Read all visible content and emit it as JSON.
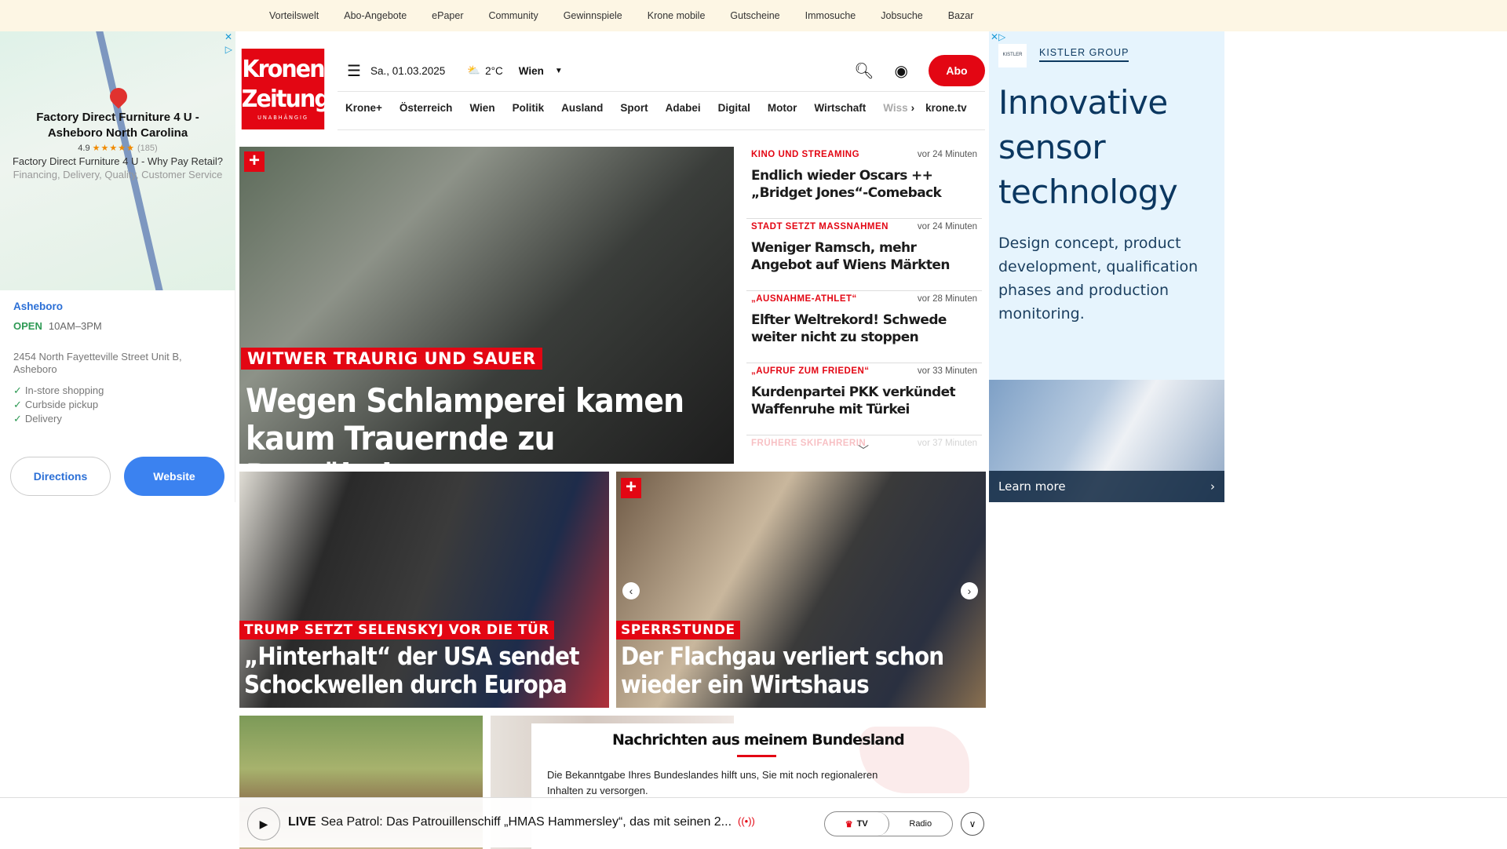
{
  "topbar": [
    "Vorteilswelt",
    "Abo-Angebote",
    "ePaper",
    "Community",
    "Gewinnspiele",
    "Krone mobile",
    "Gutscheine",
    "Immosuche",
    "Jobsuche",
    "Bazar"
  ],
  "left_ad": {
    "title": "Factory Direct Furniture 4 U - Asheboro North Carolina",
    "rating": "4.9",
    "stars": "★★★★★",
    "reviews": "(185)",
    "desc": "Factory Direct Furniture 4 U - Why Pay Retail?",
    "desc2": "Financing, Delivery, Quality, Customer Service",
    "city": "Asheboro",
    "open": "OPEN",
    "hours": "10AM–3PM",
    "address": "2454 North Fayetteville Street Unit B, Asheboro",
    "features": [
      "In-store shopping",
      "Curbside pickup",
      "Delivery"
    ],
    "directions": "Directions",
    "website": "Website"
  },
  "logo": {
    "line1": "Kronen",
    "line2": "Zeitung",
    "sub": "UNABHÄNGIG"
  },
  "header": {
    "date": "Sa., 01.03.2025",
    "temp": "2°C",
    "city": "Wien",
    "abo": "Abo"
  },
  "nav": [
    "Krone+",
    "Österreich",
    "Wien",
    "Politik",
    "Ausland",
    "Sport",
    "Adabei",
    "Digital",
    "Motor",
    "Wirtschaft",
    "Wiss",
    "krone.tv"
  ],
  "hero": {
    "kicker": "WITWER TRAURIG UND SAUER",
    "headline": "Wegen Schlamperei kamen kaum Trauernde zu Begräbnis"
  },
  "list": [
    {
      "kicker": "KINO UND STREAMING",
      "time": "vor 24 Minuten",
      "headline": "Endlich wieder Oscars ++ „Bridget Jones“-Comeback"
    },
    {
      "kicker": "STADT SETZT MASSNAHMEN",
      "time": "vor 24 Minuten",
      "headline": "Weniger Ramsch, mehr Angebot auf Wiens Märkten"
    },
    {
      "kicker": "„AUSNAHME-ATHLET“",
      "time": "vor 28 Minuten",
      "headline": "Elfter Weltrekord! Schwede weiter nicht zu stoppen"
    },
    {
      "kicker": "„AUFRUF ZUM FRIEDEN“",
      "time": "vor 33 Minuten",
      "headline": "Kurdenpartei PKK verkündet Waffenruhe mit Türkei"
    },
    {
      "kicker": "FRÜHERE SKIFAHRERIN",
      "time": "vor 37 Minuten",
      "headline": ""
    }
  ],
  "carousel": {
    "slides": 5,
    "active": 4
  },
  "cards": [
    {
      "kicker": "TRUMP SETZT SELENSKYJ VOR DIE TÜR",
      "headline": "„Hinterhalt“ der USA sendet Schockwellen durch Europa"
    },
    {
      "kicker": "SPERRSTUNDE",
      "headline": "Der Flachgau verliert schon wieder ein Wirtshaus"
    }
  ],
  "bundesland": {
    "title": "Nachrichten aus meinem Bundesland",
    "body": "Die Bekanntgabe Ihres Bundeslandes hilft uns, Sie mit noch regionaleren Inhalten zu versorgen."
  },
  "live": {
    "label": "LIVE",
    "text": "Sea Patrol: Das Patrouillenschiff „HMAS Hammersley“, das mit seinen 2...",
    "tv": "TV",
    "radio": "Radio"
  },
  "right_ad": {
    "brand": "KISTLER GROUP",
    "logo": "KISTLER",
    "title": "Innovative sensor technology",
    "desc": "Design concept, product development, qualification phases and production monitoring.",
    "cta": "Learn more"
  },
  "colors": {
    "brand_red": "#e30613",
    "ad_navy": "#0b3760",
    "link_blue": "#2b6fd6"
  }
}
